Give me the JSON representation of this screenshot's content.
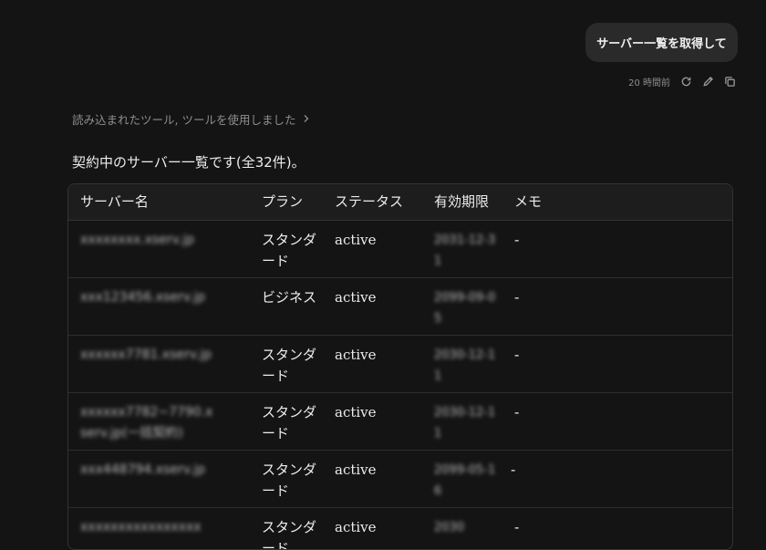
{
  "user_message": "サーバー一覧を取得して",
  "message_meta": {
    "timestamp": "20 時間前",
    "retry_icon": "refresh-icon",
    "edit_icon": "pencil-icon",
    "copy_icon": "copy-icon"
  },
  "tools_line": "読み込まれたツール, ツールを使用しました",
  "intro_text": "契約中のサーバー一覧です(全32件)。",
  "table": {
    "headers": [
      "サーバー名",
      "プラン",
      "ステータス",
      "有効期限",
      "メモ"
    ],
    "rows": [
      {
        "server": "xxxxxxxx.xserv.jp",
        "plan": "スタンダード",
        "status": "active",
        "expiry": "2031-12-31",
        "memo": "-"
      },
      {
        "server": "xxx123456.xserv.jp",
        "plan": "ビジネス",
        "status": "active",
        "expiry": "2099-09-05",
        "memo": "-"
      },
      {
        "server": "xxxxxx7781.xserv.jp",
        "plan": "スタンダード",
        "status": "active",
        "expiry": "2030-12-11",
        "memo": "-"
      },
      {
        "server": "xxxxxx7782~7790.xserv.jp(一括契約)",
        "plan": "スタンダード",
        "status": "active",
        "expiry": "2030-12-11",
        "memo": "-"
      },
      {
        "server": "xxx448794.xserv.jp",
        "plan": "スタンダード",
        "status": "active",
        "expiry": "2099-05-16",
        "memo": "-"
      },
      {
        "server": "xxxxxxxxxxxxxxxx",
        "plan": "スタンダード",
        "status": "active",
        "expiry": "2030",
        "memo": "-"
      }
    ]
  }
}
